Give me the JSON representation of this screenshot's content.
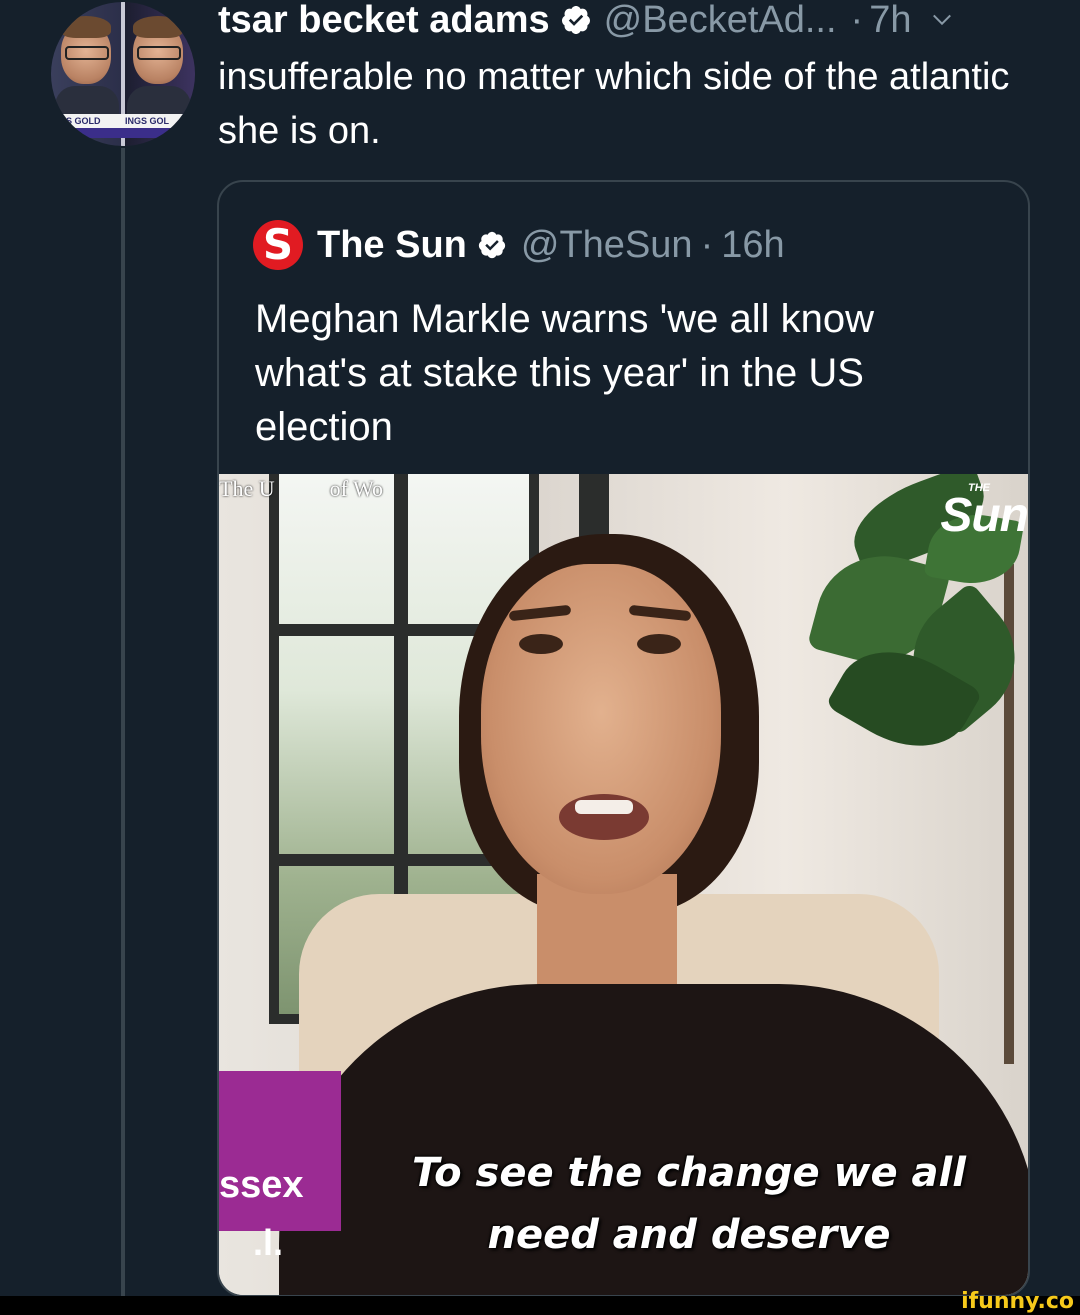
{
  "tweet": {
    "display_name": "tsar becket adams",
    "verified_icon": "verified-badge-icon",
    "handle": "@BecketAd...",
    "separator": "·",
    "time": "7h",
    "menu_icon": "chevron-down-icon",
    "text": "insufferable no matter which side of the atlantic she is on.",
    "avatar": {
      "ticker_left": "GS GOLD",
      "ticker_right": "INGS GOL"
    }
  },
  "quoted_tweet": {
    "logo_letter": "S",
    "display_name": "The Sun",
    "verified_icon": "verified-badge-icon",
    "handle": "@TheSun",
    "separator": "·",
    "time": "16h",
    "text": "Meghan Markle warns 'we all know what's at stake this year' in the US election",
    "media": {
      "top_left_watermark": "The U          of Wo",
      "brand_watermark_small": "THE",
      "brand_watermark": "Sun",
      "lower_third_text": "ssex",
      "lower_third_sub": ".l.",
      "caption_line1": "To see the change we all",
      "caption_line2": "need and deserve"
    }
  },
  "footer": {
    "watermark": "ifunny.co"
  },
  "colors": {
    "background": "#15202b",
    "secondary_text": "#8899a6",
    "border": "#38444d",
    "sun_red": "#e11b22",
    "lower_third_magenta": "#9b2b93",
    "ifunny_yellow": "#f6c91b"
  }
}
